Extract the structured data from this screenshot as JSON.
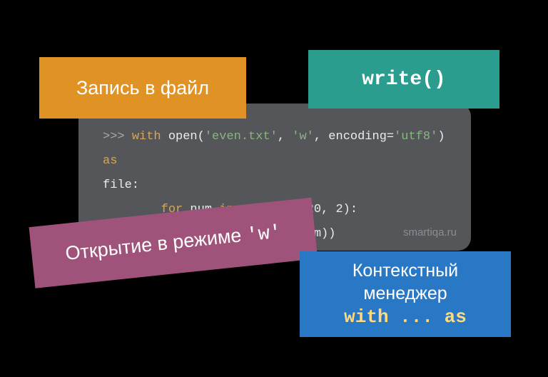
{
  "code": {
    "line1_prompt": ">>> ",
    "line1_kw1": "with",
    "line1_fn": " open(",
    "line1_arg1": "'even.txt'",
    "line1_sep1": ", ",
    "line1_arg2": "'w'",
    "line1_sep2": ", encoding=",
    "line1_arg3": "'utf8'",
    "line1_close": ") ",
    "line1_kw2": "as",
    "line2": "file:",
    "line3_pre": "        ",
    "line3_kw1": "for",
    "line3_mid": " num ",
    "line3_kw2": "in",
    "line3_rest": " range(2, 20, 2):",
    "line4": "            file.write(str(num))"
  },
  "watermark": "smartiqa.ru",
  "boxes": {
    "orange": "Запись в файл",
    "teal": "write()",
    "purple_pre": "Открытие в режиме ",
    "purple_mono": "'w'",
    "blue_line1": "Контекстный",
    "blue_line2": "менеджер",
    "blue_accent": "with ... as"
  }
}
